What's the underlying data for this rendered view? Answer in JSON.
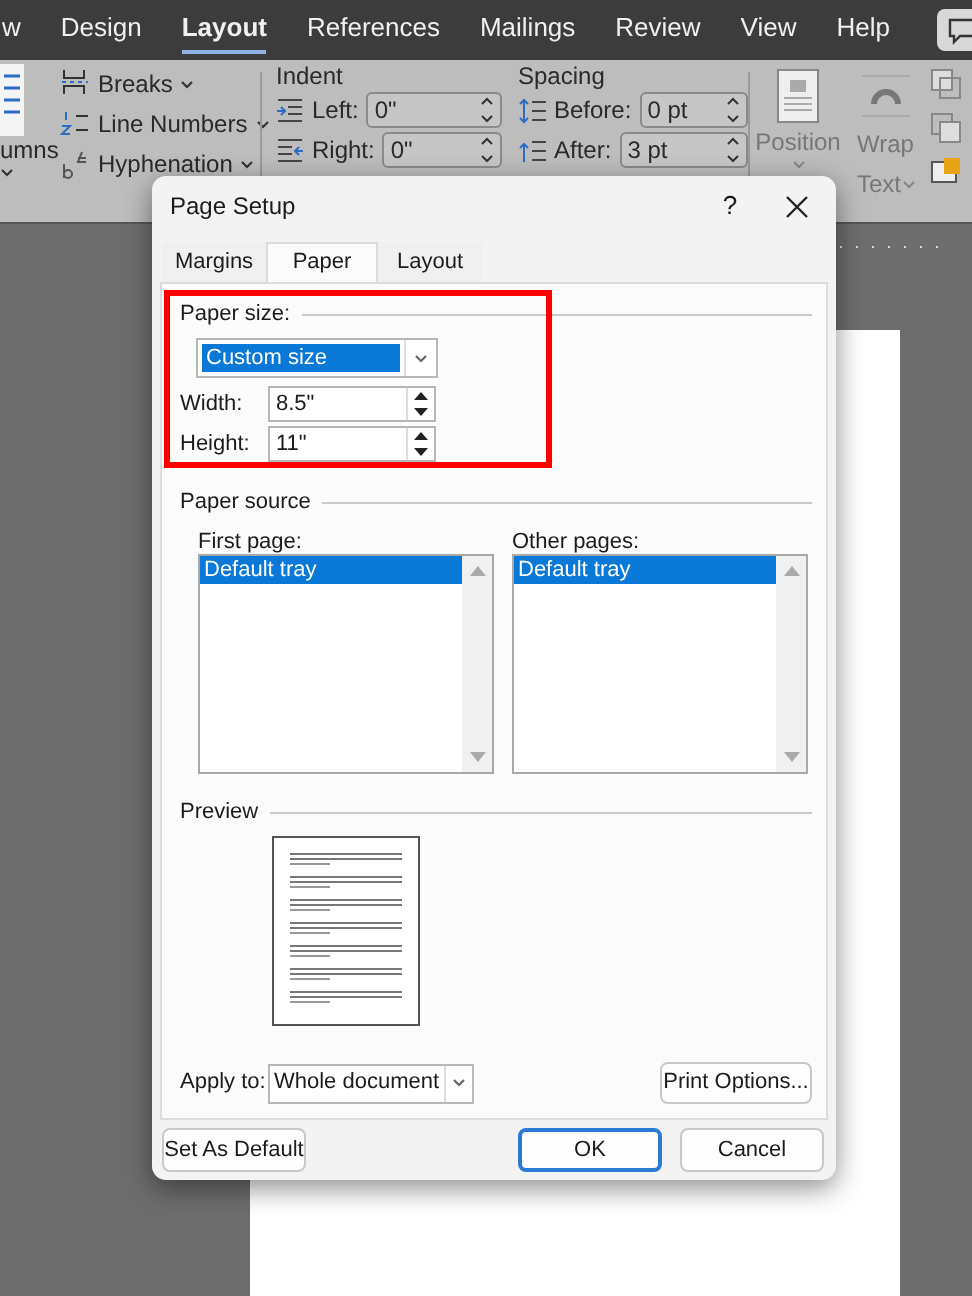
{
  "ribbon_tabs": [
    {
      "label": "w",
      "selected": false
    },
    {
      "label": "Design",
      "selected": false
    },
    {
      "label": "Layout",
      "selected": true
    },
    {
      "label": "References",
      "selected": false
    },
    {
      "label": "Mailings",
      "selected": false
    },
    {
      "label": "Review",
      "selected": false
    },
    {
      "label": "View",
      "selected": false
    },
    {
      "label": "Help",
      "selected": false
    }
  ],
  "ribbon": {
    "columns_label": "umns",
    "page_setup_items": [
      {
        "kind": "breaks",
        "label": "Breaks"
      },
      {
        "kind": "line-numbers",
        "label": "Line Numbers"
      },
      {
        "kind": "hyphenation",
        "label": "Hyphenation"
      }
    ],
    "indent": {
      "title": "Indent",
      "rows": [
        {
          "kind": "left",
          "label": "Left:",
          "value": "0\""
        },
        {
          "kind": "right",
          "label": "Right:",
          "value": "0\""
        }
      ]
    },
    "spacing": {
      "title": "Spacing",
      "rows": [
        {
          "kind": "before",
          "label": "Before:",
          "value": "0 pt"
        },
        {
          "kind": "after",
          "label": "After:",
          "value": "3 pt"
        }
      ]
    },
    "position_label": "Position",
    "wrap_label": [
      "Wrap",
      "Text"
    ]
  },
  "dialog": {
    "title": "Page Setup",
    "help": "?",
    "tabs": [
      {
        "label": "Margins",
        "selected": false
      },
      {
        "label": "Paper",
        "selected": true
      },
      {
        "label": "Layout",
        "selected": false
      }
    ],
    "paper_size": {
      "title": "Paper size:",
      "highlighted": true,
      "size": {
        "value": "Custom size",
        "focused": true
      },
      "width": {
        "label": "Width:",
        "value": "8.5\""
      },
      "height": {
        "label": "Height:",
        "value": "11\""
      }
    },
    "paper_source": {
      "title": "Paper source",
      "lists": [
        {
          "label": "First page:",
          "items": [
            {
              "label": "Default tray",
              "selected": true
            }
          ]
        },
        {
          "label": "Other pages:",
          "items": [
            {
              "label": "Default tray",
              "selected": true
            }
          ]
        }
      ]
    },
    "preview": {
      "title": "Preview"
    },
    "apply_to": {
      "label": "Apply to:",
      "value": "Whole document"
    },
    "print_options": "Print Options...",
    "buttons": [
      {
        "label": "Set As Default",
        "default": false
      },
      {
        "label": "OK",
        "default": true
      },
      {
        "label": "Cancel",
        "default": false
      }
    ]
  }
}
